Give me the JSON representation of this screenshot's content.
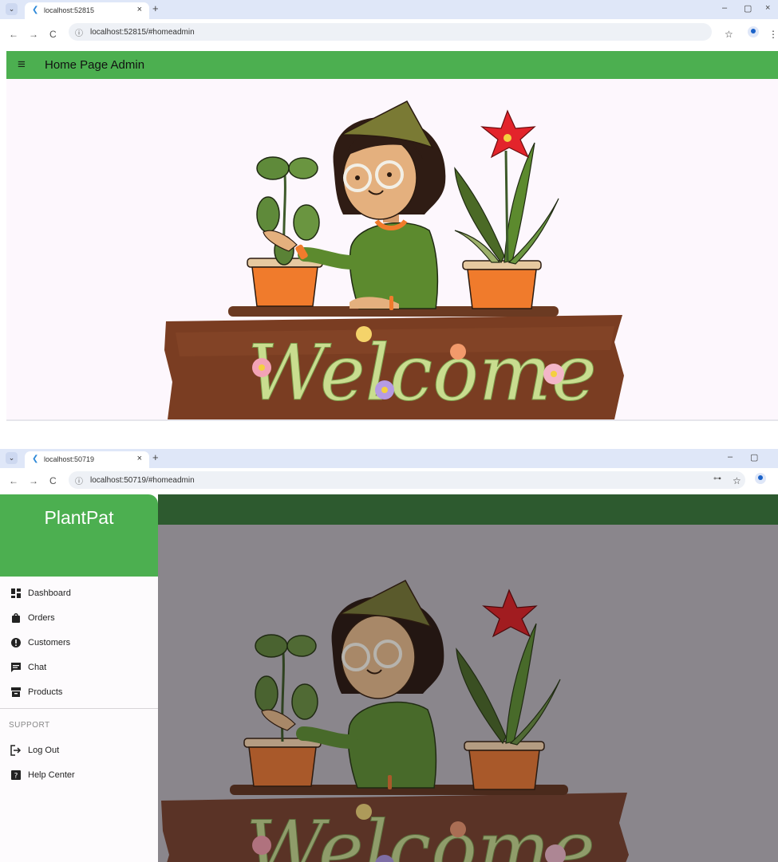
{
  "screen1": {
    "tab_title": "localhost:52815",
    "url": "localhost:52815/#homeadmin",
    "app_title": "Home Page Admin",
    "banner_text": "Welcome"
  },
  "screen2": {
    "tab_title": "localhost:50719",
    "url": "localhost:50719/#homeadmin",
    "brand": "PlantPat",
    "nav_items": [
      "Dashboard",
      "Orders",
      "Customers",
      "Chat",
      "Products"
    ],
    "section_label": "SUPPORT",
    "support_items": [
      "Log Out",
      "Help Center"
    ],
    "banner_text": "Welcome"
  },
  "icons": {
    "tab_close": "×",
    "new_tab": "+",
    "back": "←",
    "forward": "→",
    "reload": "C",
    "info": "ⓘ",
    "star": "☆",
    "menu": "≡",
    "minimize": "–",
    "restore": "▢",
    "close": "×",
    "kebab": "⋮",
    "key": "⊶"
  },
  "colors": {
    "app_green": "#4caf50",
    "dark_green": "#2d5a2f",
    "page_bg": "#fdf7fd",
    "scrim": "#8a868c"
  }
}
